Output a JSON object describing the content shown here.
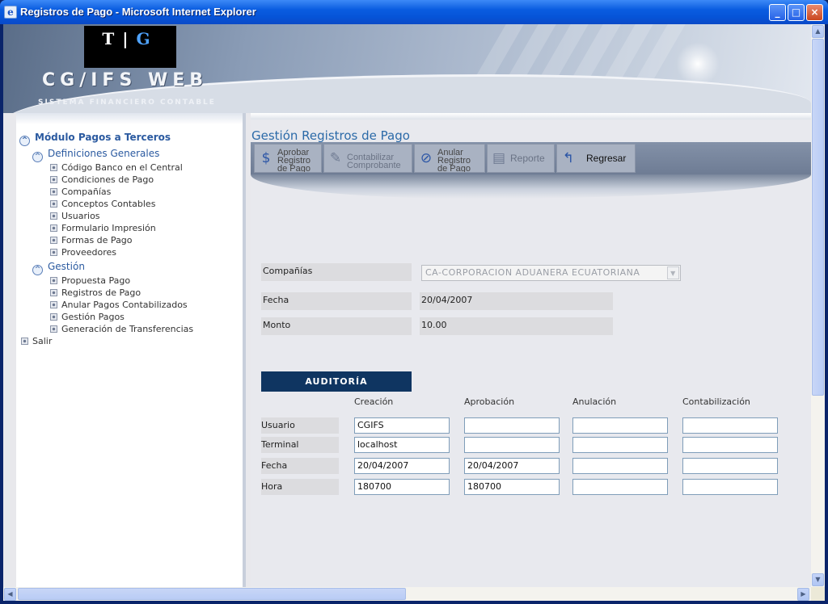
{
  "window": {
    "title": "Registros de Pago - Microsoft Internet Explorer",
    "buttons": {
      "minimize": "_",
      "maximize": "□",
      "close": "×"
    }
  },
  "banner": {
    "logo_left": "T",
    "logo_right": "G",
    "brand": "CG/IFS WEB",
    "subtitle": "SISTEMA FINANCIERO CONTABLE"
  },
  "sidebar": {
    "module": "Módulo Pagos a Terceros",
    "sections": [
      {
        "title": "Definiciones Generales",
        "items": [
          "Código Banco en el Central",
          "Condiciones de Pago",
          "Compañías",
          "Conceptos Contables",
          "Usuarios",
          "Formulario Impresión",
          "Formas de Pago",
          "Proveedores"
        ]
      },
      {
        "title": "Gestión",
        "items": [
          "Propuesta Pago",
          "Registros de Pago",
          "Anular Pagos Contabilizados",
          "Gestión Pagos",
          "Generación de Transferencias"
        ]
      }
    ],
    "exit": "Salir"
  },
  "main": {
    "title": "Gestión Registros de Pago",
    "toolbar": {
      "approve": "Aprobar\nRegistro\nde Pago",
      "post": "Contabilizar\nComprobante",
      "void": "Anular\nRegistro\nde Pago",
      "report": "Reporte",
      "back": "Regresar"
    },
    "form": {
      "company_label": "Compañías",
      "company_value": "CA-CORPORACION ADUANERA ECUATORIANA",
      "date_label": "Fecha",
      "date_value": "20/04/2007",
      "amount_label": "Monto",
      "amount_value": "10.00"
    },
    "audit": {
      "header": "AUDITORÍA",
      "columns": [
        "Creación",
        "Aprobación",
        "Anulación",
        "Contabilización"
      ],
      "rows": [
        {
          "label": "Usuario",
          "values": [
            "CGIFS",
            "",
            "",
            ""
          ]
        },
        {
          "label": "Terminal",
          "values": [
            "localhost",
            "",
            "",
            ""
          ]
        },
        {
          "label": "Fecha",
          "values": [
            "20/04/2007",
            "20/04/2007",
            "",
            ""
          ]
        },
        {
          "label": "Hora",
          "values": [
            "180700",
            "180700",
            "",
            ""
          ]
        }
      ]
    }
  },
  "icons": {
    "ie": "ie-icon",
    "tree_expand": "collapse-arrow-icon",
    "bullet": "bullet-icon"
  }
}
